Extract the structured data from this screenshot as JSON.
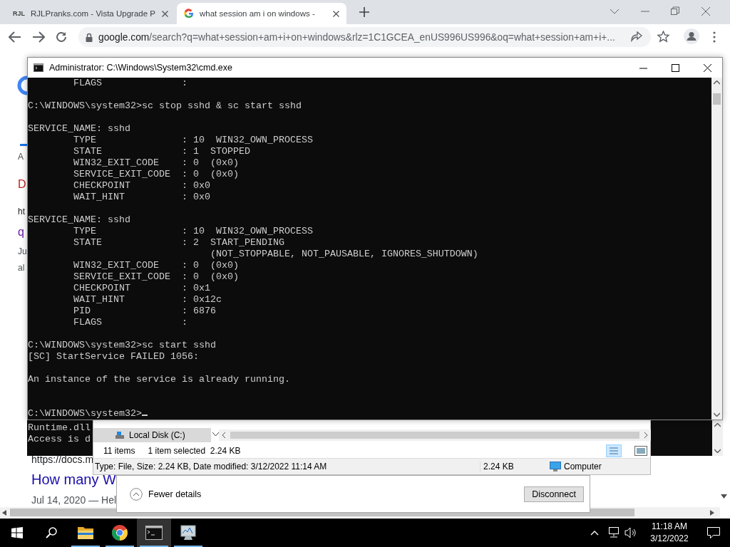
{
  "browser": {
    "tabs": [
      {
        "favicon_text": "RJL",
        "title": "RJLPranks.com - Vista Upgrade P",
        "selected": false
      },
      {
        "title": "what session am i on windows - ",
        "selected": true
      }
    ],
    "address": {
      "domain": "google.com",
      "path": "/search?q=what+session+am+i+on+windows&rlz=1C1GCEA_enUS996US996&oq=what+session+am+i+..."
    },
    "page_fragments": [
      {
        "text": "A",
        "kind": "snippet"
      },
      {
        "text": "D",
        "kind": "heading",
        "color": "#c5221f"
      },
      {
        "text": "ht",
        "kind": "url"
      },
      {
        "text": "q",
        "kind": "heading",
        "color": "#681da8"
      },
      {
        "text": "Ju",
        "kind": "snippet"
      },
      {
        "text": "al",
        "kind": "snippet"
      }
    ],
    "page_results": [
      {
        "text": "https://docs.m",
        "kind": "url"
      },
      {
        "text": "How many W",
        "kind": "heading",
        "color": "#1a0dab"
      },
      {
        "text": "Jul 14, 2020 — Hel",
        "kind": "snippet"
      }
    ]
  },
  "back_console": {
    "lines": [
      "Runtime.dll",
      "Access is d"
    ]
  },
  "explorer": {
    "nav_items": [
      {
        "label": "Local Disk (C:)",
        "selected": true
      }
    ],
    "item_count": "11 items",
    "selection": "1 item selected  2.24 KB",
    "details": "Type: File, Size: 2.24 KB, Date modified: 3/12/2022 11:14 AM",
    "size": "2.24 KB",
    "location": "Computer"
  },
  "rdp_dialog": {
    "toggle": "Fewer details",
    "button": "Disconnect"
  },
  "cmd": {
    "title": "Administrator: C:\\Windows\\System32\\cmd.exe",
    "lines": [
      {
        "kind": "text",
        "text": "        FLAGS              :"
      },
      {
        "kind": "blank"
      },
      {
        "kind": "text",
        "text": "C:\\WINDOWS\\system32>sc stop sshd & sc start sshd"
      },
      {
        "kind": "blank"
      },
      {
        "kind": "text",
        "text": "SERVICE_NAME: sshd"
      },
      {
        "kind": "text",
        "text": "        TYPE               : 10  WIN32_OWN_PROCESS"
      },
      {
        "kind": "text",
        "text": "        STATE              : 1  STOPPED"
      },
      {
        "kind": "text",
        "text": "        WIN32_EXIT_CODE    : 0  (0x0)"
      },
      {
        "kind": "text",
        "text": "        SERVICE_EXIT_CODE  : 0  (0x0)"
      },
      {
        "kind": "text",
        "text": "        CHECKPOINT         : 0x0"
      },
      {
        "kind": "text",
        "text": "        WAIT_HINT          : 0x0"
      },
      {
        "kind": "blank"
      },
      {
        "kind": "text",
        "text": "SERVICE_NAME: sshd"
      },
      {
        "kind": "text",
        "text": "        TYPE               : 10  WIN32_OWN_PROCESS"
      },
      {
        "kind": "text",
        "text": "        STATE              : 2  START_PENDING"
      },
      {
        "kind": "text",
        "text": "                                (NOT_STOPPABLE, NOT_PAUSABLE, IGNORES_SHUTDOWN)"
      },
      {
        "kind": "text",
        "text": "        WIN32_EXIT_CODE    : 0  (0x0)"
      },
      {
        "kind": "text",
        "text": "        SERVICE_EXIT_CODE  : 0  (0x0)"
      },
      {
        "kind": "text",
        "text": "        CHECKPOINT         : 0x1"
      },
      {
        "kind": "text",
        "text": "        WAIT_HINT          : 0x12c"
      },
      {
        "kind": "text",
        "text": "        PID                : 6876"
      },
      {
        "kind": "text",
        "text": "        FLAGS              :"
      },
      {
        "kind": "blank"
      },
      {
        "kind": "text",
        "text": "C:\\WINDOWS\\system32>sc start sshd"
      },
      {
        "kind": "text",
        "text": "[SC] StartService FAILED 1056:"
      },
      {
        "kind": "blank"
      },
      {
        "kind": "text",
        "text": "An instance of the service is already running."
      },
      {
        "kind": "blank"
      },
      {
        "kind": "blank"
      },
      {
        "kind": "prompt",
        "text": "C:\\WINDOWS\\system32>",
        "cursor": true
      }
    ]
  },
  "taskbar": {
    "apps": [
      {
        "kind": "folder",
        "selected": false
      },
      {
        "kind": "browser",
        "selected": false
      },
      {
        "kind": "terminal",
        "selected": true
      },
      {
        "kind": "monitor",
        "selected": false
      }
    ],
    "time": "11:18 AM",
    "date": "3/12/2022"
  }
}
